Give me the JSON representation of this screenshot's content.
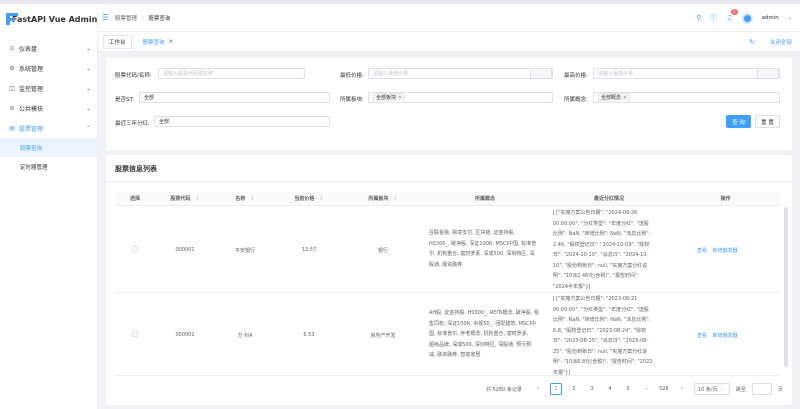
{
  "app": {
    "title": "FastAPI Vue Admin"
  },
  "sidebar": {
    "items": [
      {
        "label": "仪表盘",
        "icon": "dashboard-icon",
        "arrow": "⌄"
      },
      {
        "label": "系统管理",
        "icon": "settings-icon",
        "arrow": "⌄"
      },
      {
        "label": "监控管理",
        "icon": "monitor-icon",
        "arrow": "⌄"
      },
      {
        "label": "公共模块",
        "icon": "module-icon",
        "arrow": "⌄"
      },
      {
        "label": "股票管理",
        "icon": "stock-icon",
        "arrow": "⌃"
      }
    ],
    "subitems": [
      {
        "label": "股票查询"
      },
      {
        "label": "定时器管理"
      }
    ]
  },
  "header": {
    "breadcrumb": [
      "股票管理",
      "股票查询"
    ],
    "separator": "/",
    "badge_count": "1",
    "user": "admin"
  },
  "tabs": {
    "items": [
      {
        "label": "工作台"
      },
      {
        "label": "股票查询"
      }
    ],
    "refresh": "↻",
    "close_all": "关闭全部"
  },
  "search": {
    "stock_code": {
      "label": "股票代码/名称:",
      "placeholder": "请输入股票代码或名称"
    },
    "min_price": {
      "label": "最低价格:",
      "placeholder": "请输入最低价格"
    },
    "max_price": {
      "label": "最高价格:",
      "placeholder": "请输入最高价格"
    },
    "is_st": {
      "label": "是否ST:",
      "value": "全部"
    },
    "board": {
      "label": "所属板块:",
      "tag": "全部板块"
    },
    "concept": {
      "label": "所属概念:",
      "tag": "全部概念"
    },
    "dividend": {
      "label": "最近三年分红:",
      "value": "全部"
    },
    "query_button": "查 询",
    "reset_button": "重 置"
  },
  "table": {
    "title": "股票信息列表",
    "columns": [
      "选择",
      "股票代码",
      "名称",
      "当前价格",
      "所属板块",
      "所属概念",
      "最近分红情况",
      "操作"
    ],
    "rows": [
      {
        "code": "000001",
        "name": "平安银行",
        "price": "12.57",
        "board": "银行",
        "concepts": [
          "互联金融, 跨境支付, 区块链, 证金持股,",
          "HS300_, 破净股, 深证100R, MSCI中国, 标准普",
          "尔, 机构重仓, 富时罗素, 深成500, 深圳特区, 深",
          "股通, 融资融券"
        ],
        "dividend": [
          "[{\"实施方案公告日期\": \"2024-09-26",
          "00:00:00\", \"分红类型\": \"年度分红\", \"送股",
          "比例\": NaN, \"转增比例\": NaN, \"派息比例\":",
          "2.46, \"股权登记日\": \"2024-10-09\", \"除权",
          "日\": \"2024-10-10\", \"派息日\": \"2024-10-",
          "10\", \"股份到账日\": null, \"实施方案分红说",
          "明\": \"10派2.46元(含税)\", \"报告时间\":",
          "\"2024半年报\"}]"
        ],
        "actions": [
          "查看",
          "新增触发器"
        ]
      },
      {
        "code": "000002",
        "name": "万 科A",
        "price": "6.53",
        "board": "房地产开发",
        "concepts": [
          "AH股, 证金持股, HS300_, REITs概念, 破净股, 租",
          "售同权, 深证100R, 央视50_, 团配建筑, MSCI中",
          "国, 标准普尔, 养老概念, 机构重仓, 富时罗素,",
          "超级品牌, 深成500, 深圳特区, 深股通, 预亏预",
          "减, 融资融券, 智能家居"
        ],
        "dividend": [
          "[{\"实施方案公告日期\": \"2023-08-21",
          "00:00:00\", \"分红类型\": \"年度分红\", \"送股",
          "比例\": NaN, \"转增比例\": NaN, \"派息比例\":",
          "6.8, \"股权登记日\": \"2023-08-24\", \"除权",
          "日\": \"2023-08-25\", \"派息日\": \"2023-08-",
          "25\", \"股份到账日\": null, \"实施方案分红说",
          "明\": \"10派6.8元(含税)\", \"报告时间\": \"2022",
          "年报\"}]"
        ],
        "actions": [
          "查看",
          "新增触发器"
        ]
      }
    ]
  },
  "pagination": {
    "total": "共 5260 条记录",
    "prev": "‹",
    "pages": [
      "1",
      "2",
      "3",
      "4",
      "5"
    ],
    "ellipsis": "···",
    "last": "526",
    "next": "›",
    "page_size": "10 条/页",
    "goto_label": "跳至",
    "page_suffix": "页"
  },
  "colors": {
    "primary": "#409eff",
    "badge": "#f56c6c"
  }
}
